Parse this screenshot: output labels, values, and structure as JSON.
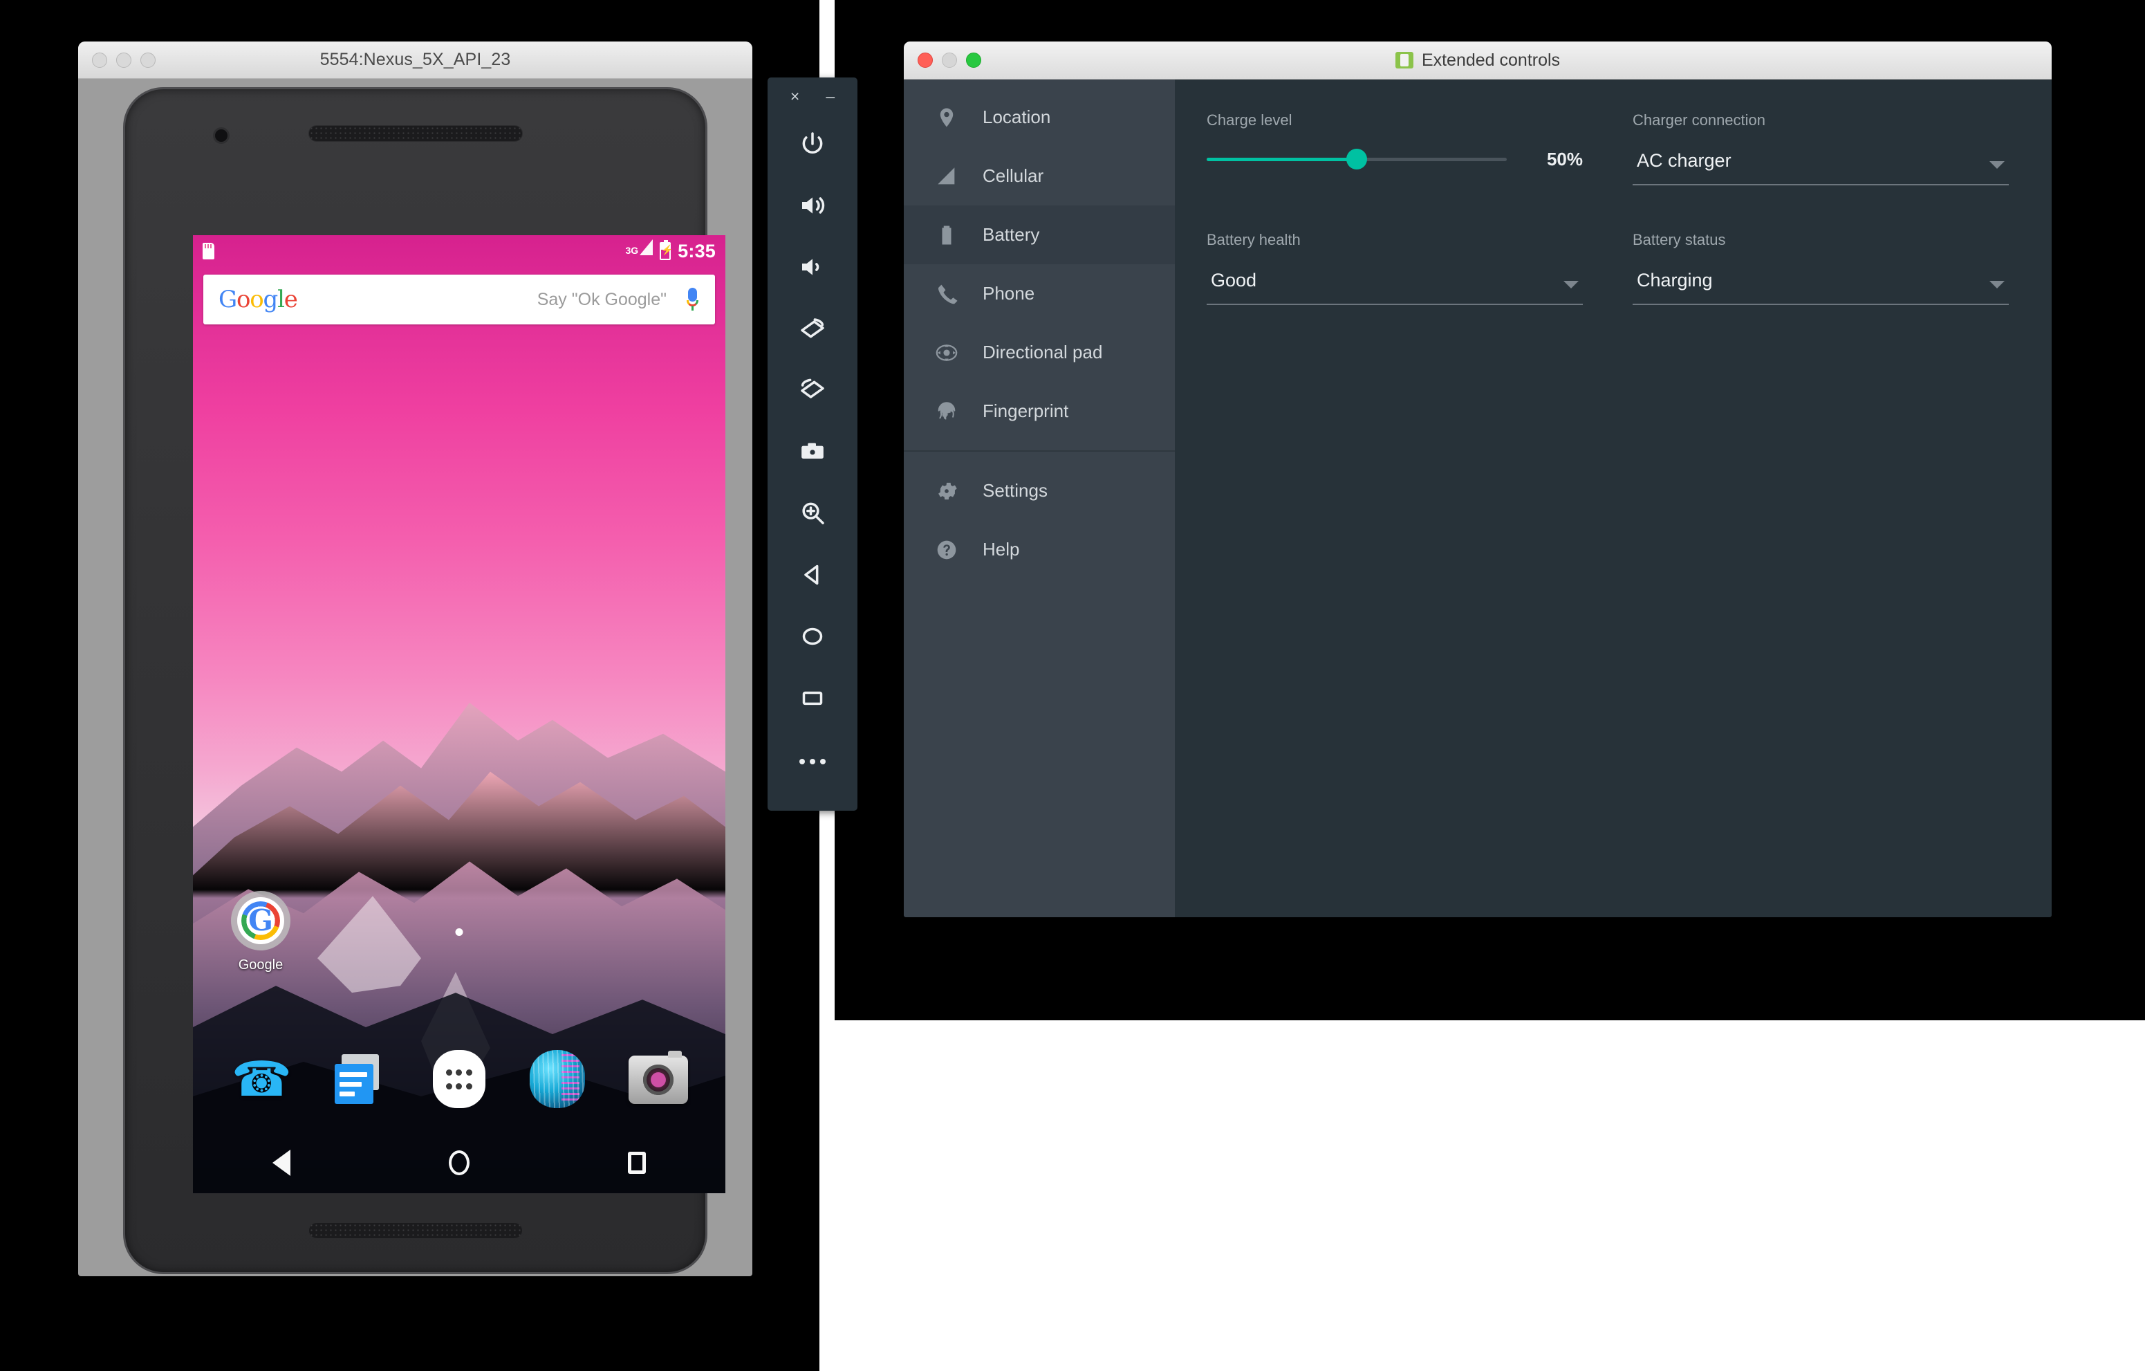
{
  "emulator_window": {
    "title": "5554:Nexus_5X_API_23",
    "traffic_lights": [
      "close",
      "minimize",
      "zoom"
    ],
    "android": {
      "status_bar": {
        "sd_card_icon": "sd-card-icon",
        "network_label": "3G",
        "battery_icon": "battery-charging-icon",
        "time": "5:35"
      },
      "search_widget": {
        "logo_letters": [
          "G",
          "o",
          "o",
          "g",
          "l",
          "e"
        ],
        "placeholder": "Say \"Ok Google\"",
        "mic_icon": "microphone-icon"
      },
      "home_apps": [
        {
          "label": "Google",
          "icon": "google-folder-icon"
        }
      ],
      "page_indicator_dots": 1,
      "dock": [
        {
          "label": "Phone",
          "icon": "phone-icon"
        },
        {
          "label": "Messenger",
          "icon": "messages-icon"
        },
        {
          "label": "Apps",
          "icon": "all-apps-icon"
        },
        {
          "label": "Browser",
          "icon": "browser-icon"
        },
        {
          "label": "Camera",
          "icon": "camera-icon"
        }
      ],
      "nav_bar": [
        {
          "label": "Back",
          "icon": "back-triangle-icon"
        },
        {
          "label": "Home",
          "icon": "home-circle-icon"
        },
        {
          "label": "Recents",
          "icon": "recents-square-icon"
        }
      ]
    }
  },
  "emulator_toolbar": {
    "close_label": "×",
    "minimize_label": "–",
    "buttons": [
      {
        "name": "power-button",
        "icon": "power-icon"
      },
      {
        "name": "volume-up-button",
        "icon": "volume-up-icon"
      },
      {
        "name": "volume-down-button",
        "icon": "volume-down-icon"
      },
      {
        "name": "rotate-left-button",
        "icon": "rotate-left-icon"
      },
      {
        "name": "rotate-right-button",
        "icon": "rotate-right-icon"
      },
      {
        "name": "screenshot-button",
        "icon": "camera-icon"
      },
      {
        "name": "zoom-button",
        "icon": "zoom-in-icon"
      },
      {
        "name": "back-button",
        "icon": "back-triangle-icon"
      },
      {
        "name": "home-button",
        "icon": "home-circle-icon"
      },
      {
        "name": "overview-button",
        "icon": "recents-square-icon"
      },
      {
        "name": "more-button",
        "icon": "more-dots-icon"
      }
    ]
  },
  "extended_controls": {
    "title": "Extended controls",
    "app_icon": "android-device-icon",
    "traffic_lights": {
      "close": "#ff5f57",
      "minimize": "#d6d6d6",
      "zoom": "#28c840"
    },
    "sidebar": {
      "items": [
        {
          "label": "Location",
          "icon": "location-pin-icon",
          "selected": false
        },
        {
          "label": "Cellular",
          "icon": "signal-bars-icon",
          "selected": false
        },
        {
          "label": "Battery",
          "icon": "battery-icon",
          "selected": true
        },
        {
          "label": "Phone",
          "icon": "phone-handset-icon",
          "selected": false
        },
        {
          "label": "Directional pad",
          "icon": "dpad-icon",
          "selected": false
        },
        {
          "label": "Fingerprint",
          "icon": "fingerprint-icon",
          "selected": false
        }
      ],
      "footer_items": [
        {
          "label": "Settings",
          "icon": "gear-icon"
        },
        {
          "label": "Help",
          "icon": "help-circle-icon"
        }
      ]
    },
    "battery_panel": {
      "charge_level": {
        "label": "Charge level",
        "value_percent": 50,
        "value_text": "50%",
        "min": 0,
        "max": 100,
        "accent_color": "#00c1a2"
      },
      "charger_connection": {
        "label": "Charger connection",
        "value": "AC charger"
      },
      "battery_health": {
        "label": "Battery health",
        "value": "Good"
      },
      "battery_status": {
        "label": "Battery status",
        "value": "Charging"
      }
    }
  }
}
